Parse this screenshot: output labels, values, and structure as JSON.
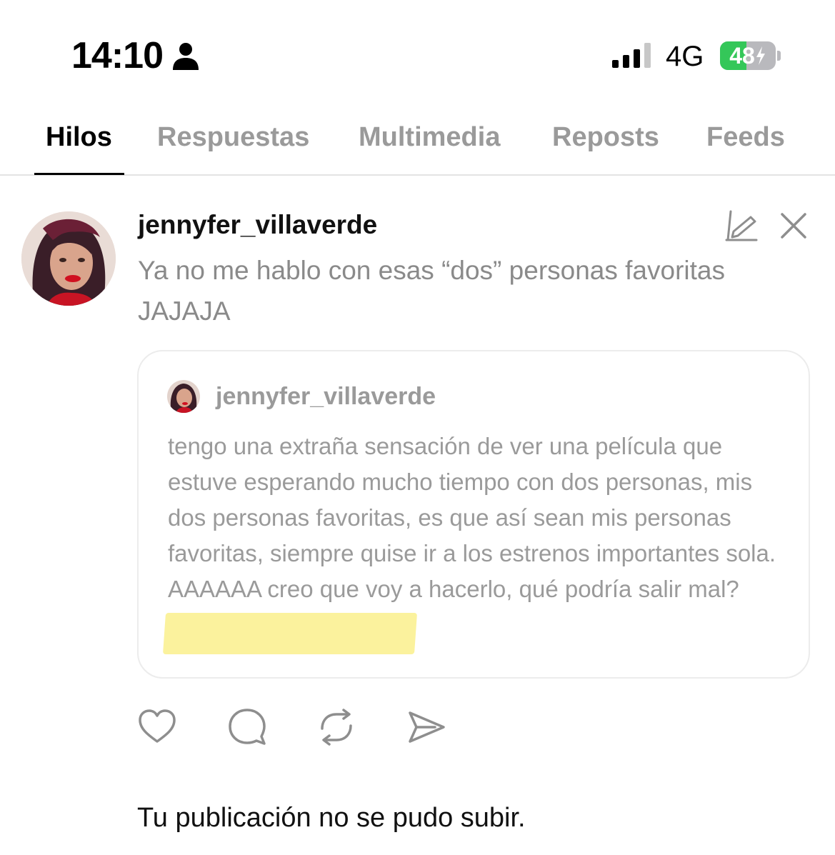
{
  "status_bar": {
    "time": "14:10",
    "network": "4G",
    "battery_level": "48",
    "battery_fraction": 0.48,
    "icons": [
      "person-icon",
      "signal-icon",
      "battery-charging-icon"
    ]
  },
  "tabs": [
    {
      "label": "Hilos",
      "active": true
    },
    {
      "label": "Respuestas",
      "active": false
    },
    {
      "label": "Multimedia",
      "active": false
    },
    {
      "label": "Reposts",
      "active": false
    },
    {
      "label": "Feeds",
      "active": false
    }
  ],
  "post": {
    "username": "jennyfer_villaverde",
    "text": "Ya no me hablo con esas “dos” personas favoritas JAJAJA",
    "icons": [
      "draft-edit-icon",
      "close-icon"
    ],
    "quote": {
      "username": "jennyfer_villaverde",
      "text": "tengo una extraña sensación de ver una película que estuve esperando mucho tiempo con dos personas, mis dos personas favoritas, es que así sean mis personas favoritas, siempre quise ir a los estrenos importantes sola. AAAAAA creo que voy a hacerlo, qué podría salir mal?",
      "highlight_color": "#fbf29d"
    },
    "actions": [
      "heart-icon",
      "comment-icon",
      "repost-icon",
      "share-icon"
    ]
  },
  "error_message": "Tu publicación no se pudo subir.",
  "colors": {
    "active_tab": "#000000",
    "inactive_tab": "#9a9a9a",
    "battery_green": "#34c759",
    "muted_text": "#8a8a8a"
  }
}
